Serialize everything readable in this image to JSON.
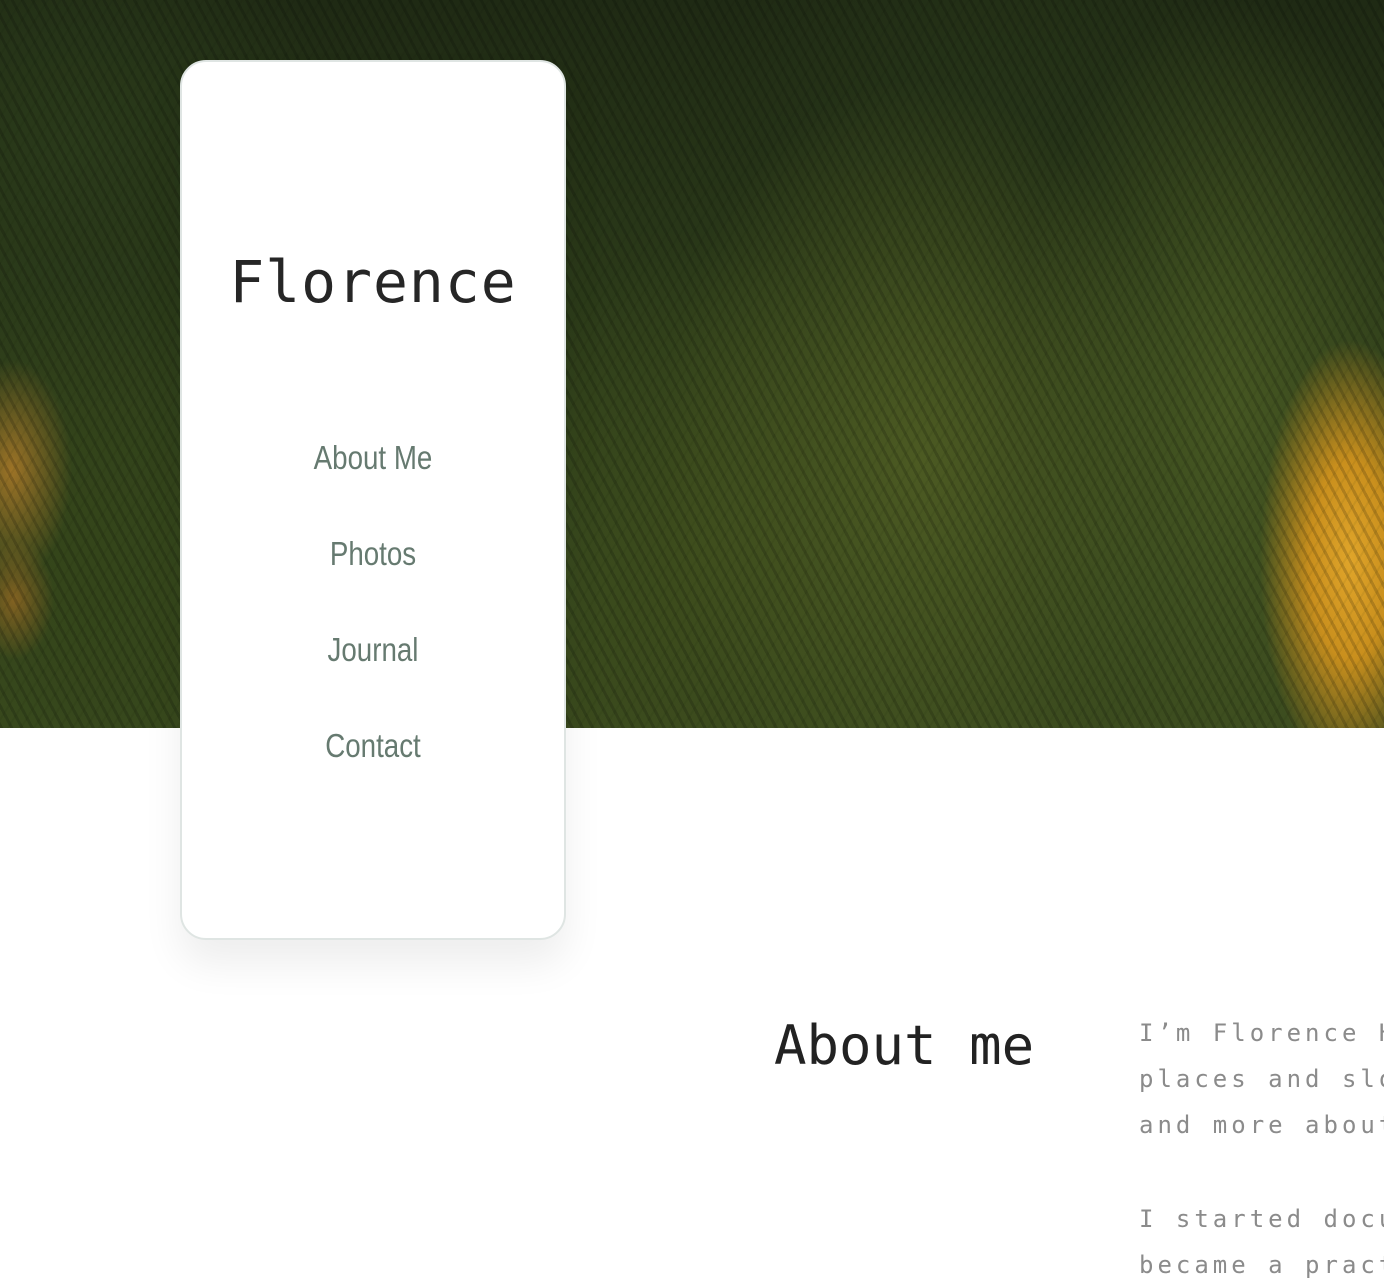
{
  "site": {
    "brand": "Florence"
  },
  "nav": {
    "items": [
      {
        "label": "About Me"
      },
      {
        "label": "Photos"
      },
      {
        "label": "Journal"
      },
      {
        "label": "Contact"
      }
    ]
  },
  "about": {
    "heading": "About me",
    "paragraphs": [
      {
        "lines": [
          "I’m Florence Ha",
          "places and slow",
          "and more about"
        ]
      },
      {
        "lines": [
          "I started docum",
          "became a practi"
        ]
      }
    ]
  }
}
